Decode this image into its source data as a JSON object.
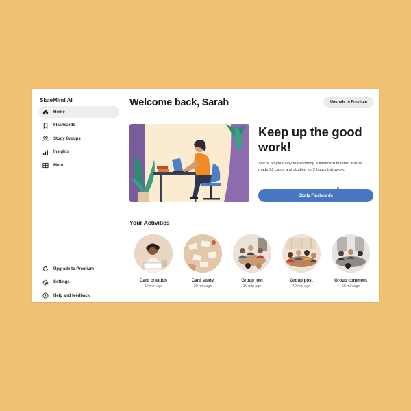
{
  "sidebar": {
    "brand": "SlateMind AI",
    "items": [
      {
        "label": "Home",
        "icon": "home-icon",
        "active": true
      },
      {
        "label": "Flashcards",
        "icon": "bookmark-icon"
      },
      {
        "label": "Study Groups",
        "icon": "group-icon"
      },
      {
        "label": "Insights",
        "icon": "chart-icon"
      },
      {
        "label": "More",
        "icon": "grid-icon"
      }
    ],
    "bottom": [
      {
        "label": "Upgrade to Premium",
        "icon": "refresh-icon"
      },
      {
        "label": "Settings",
        "icon": "gear-icon"
      },
      {
        "label": "Help and feedback",
        "icon": "help-icon"
      }
    ]
  },
  "header": {
    "title": "Welcome back, Sarah",
    "upgrade_label": "Upgrade to Premium"
  },
  "hero": {
    "heading": "Keep up the good work!",
    "text": "You're on your way to becoming a flashcard master. You've made 30 cards and studied for 2 hours this week.",
    "button_label": "Study Flashcards"
  },
  "activities": {
    "title": "Your Activities",
    "items": [
      {
        "label": "Card creation",
        "time": "10 min ago"
      },
      {
        "label": "Card study",
        "time": "20 min ago"
      },
      {
        "label": "Group join",
        "time": "30 min ago"
      },
      {
        "label": "Group post",
        "time": "40 min ago"
      },
      {
        "label": "Group comment",
        "time": "50 min ago"
      }
    ]
  },
  "colors": {
    "background": "#EFC170",
    "accent": "#4777C2",
    "active_nav": "#eeeeee"
  }
}
